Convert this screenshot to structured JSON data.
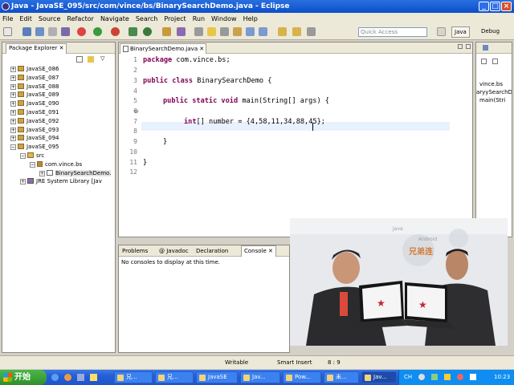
{
  "window": {
    "title": "Java - JavaSE_095/src/com/vince/bs/BinarySearchDemo.java - Eclipse"
  },
  "menu": [
    "File",
    "Edit",
    "Source",
    "Refactor",
    "Navigate",
    "Search",
    "Project",
    "Run",
    "Window",
    "Help"
  ],
  "toolbar": {
    "quick_access_placeholder": "Quick Access",
    "perspectives": [
      "Java",
      "Debug"
    ]
  },
  "package_explorer": {
    "title": "Package Explorer",
    "projects": [
      "JavaSE_086",
      "JavaSE_087",
      "JavaSE_088",
      "JavaSE_089",
      "JavaSE_090",
      "JavaSE_091",
      "JavaSE_092",
      "JavaSE_093",
      "JavaSE_094",
      "JavaSE_095"
    ],
    "src": "src",
    "package": "com.vince.bs",
    "file": "BinarySearchDemo.",
    "library": "JRE System Library [Jav"
  },
  "editor": {
    "tab": "BinarySearchDemo.java",
    "line_numbers": [
      "1",
      "2",
      "3",
      "4",
      "5",
      "6",
      "7",
      "8",
      "9",
      "10",
      "11",
      "12"
    ],
    "lines": {
      "l1_kw": "package",
      "l1_rest": " com.vince.bs;",
      "l3_kw": "public class",
      "l3_rest": " BinarySearchDemo {",
      "l5_kw": "public static void",
      "l5_rest": " main(String[] args) {",
      "l7_kw": "int",
      "l7_rest": "[] number = {4,58,11,34,88,45};",
      "l9": "}",
      "l11": "}"
    }
  },
  "outline": {
    "items": [
      "vince.bs",
      "aryySearchDe",
      "main(Stri"
    ]
  },
  "console": {
    "tabs": [
      "Problems",
      "Javadoc",
      "Declaration",
      "Console"
    ],
    "message": "No consoles to display at this time."
  },
  "video": {
    "sign_text": "兄弟连",
    "bg_words": [
      "Android",
      "Java"
    ]
  },
  "status": {
    "mode": "Writable",
    "insert": "Smart Insert",
    "position": "8 : 9"
  },
  "taskbar": {
    "start": "开始",
    "tasks": [
      "兄...",
      "兄...",
      "JavaSE",
      "Jav...",
      "Pow...",
      "未...",
      "Jav..."
    ],
    "tray_lang": "CH",
    "clock": "10:23"
  },
  "colors": {
    "keyword": "#7f0055",
    "current_line": "#e8f2fe",
    "titlebar": "#0b4fc9"
  }
}
